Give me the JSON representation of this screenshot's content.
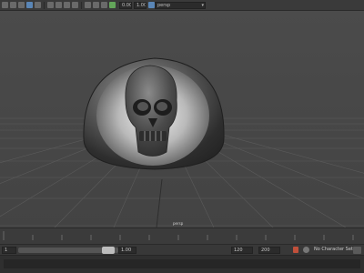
{
  "toolbar": {
    "camera_field": "persp",
    "frame_value": "0.00",
    "scale_value": "1.00"
  },
  "viewport": {
    "camera_name": "persp",
    "model": "skull-relief-plaque"
  },
  "range": {
    "start_value": "1",
    "range_start_value": "1.00",
    "range_end_value": "120",
    "end_value": "200",
    "character_set": "No Character Set"
  },
  "colors": {
    "viewport": "#444444",
    "panel": "#3a3a3a",
    "accent": "#5a86b6",
    "key": "#c0503b"
  }
}
